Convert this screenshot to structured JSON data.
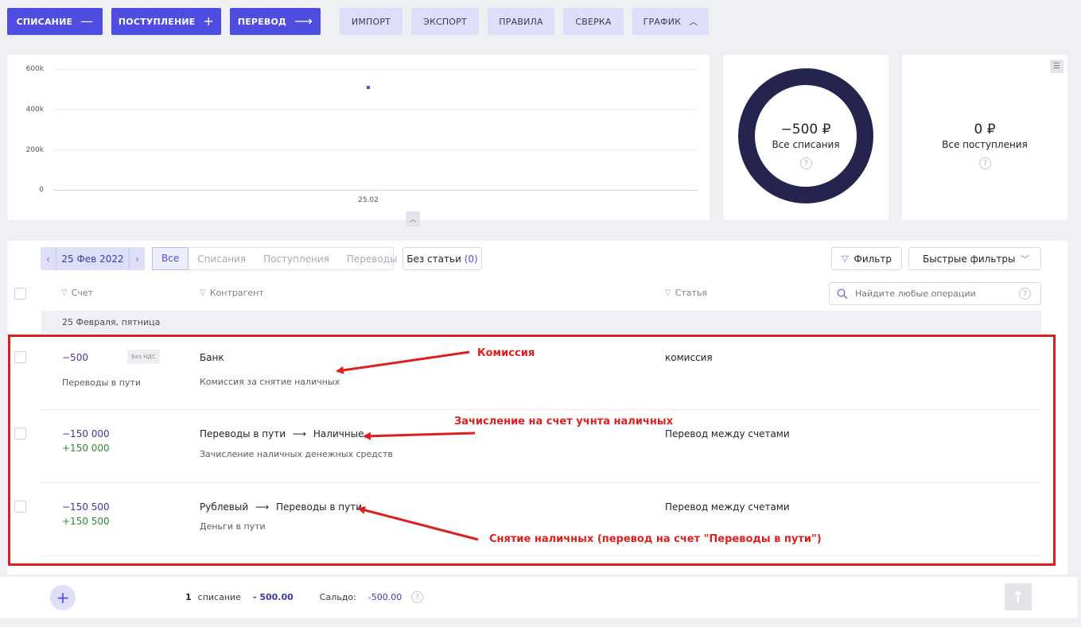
{
  "toolbar": {
    "writeoff": "СПИСАНИЕ",
    "income": "ПОСТУПЛЕНИЕ",
    "transfer": "ПЕРЕВОД",
    "import": "ИМПОРТ",
    "export": "ЭКСПОРТ",
    "rules": "ПРАВИЛА",
    "reconcile": "СВЕРКА",
    "chart": "ГРАФИК"
  },
  "chart_data": {
    "type": "scatter",
    "categories": [
      "25.02"
    ],
    "yticks": [
      "600k",
      "400k",
      "200k",
      "0"
    ],
    "ylim": [
      0,
      600000
    ],
    "series": [
      {
        "values": [
          510000
        ],
        "color": "#4f4de0"
      }
    ]
  },
  "summary": {
    "writeoffs_value": "−500 ₽",
    "writeoffs_label": "Все списания",
    "income_value": "0 ₽",
    "income_label": "Все поступления",
    "help": "?"
  },
  "filters": {
    "date": "25 Фев 2022",
    "tabs": [
      "Все",
      "Списания",
      "Поступления",
      "Переводы"
    ],
    "no_article": "Без статьи",
    "no_article_count": "(0)",
    "filter": "Фильтр",
    "quick_filters": "Быстрые фильтры",
    "search_placeholder": "Найдите любые операции"
  },
  "columns": {
    "account": "Счет",
    "counterparty": "Контрагент",
    "article": "Статья"
  },
  "group_header": "25 Февраля, пятница",
  "rows": [
    {
      "amount1": "−500",
      "badge": "Без НДС",
      "account": "Переводы в пути",
      "counterparty": "Банк",
      "description": "Комиссия за снятие наличных",
      "article": "комиссия"
    },
    {
      "amount1": "−150 000",
      "amount2": "+150 000",
      "from": "Переводы в пути",
      "to": "Наличные",
      "description": "Зачисление наличных денежных средств",
      "article": "Перевод между счетами"
    },
    {
      "amount1": "−150 500",
      "amount2": "+150 500",
      "from": "Рублевый",
      "to": "Переводы в пути",
      "description": "Деньги в пути",
      "article": "Перевод между счетами"
    }
  ],
  "annotations": {
    "a1": "Комиссия",
    "a2": "Зачисление на счет учнта наличных",
    "a3": "Снятие наличных (перевод на счет \"Переводы в пути\")"
  },
  "footer": {
    "count": "1",
    "count_label": "списание",
    "sum": "- 500.00",
    "balance_label": "Сальдо:",
    "balance": "-500.00"
  },
  "colors": {
    "accent": "#4f4de0",
    "donut": "#25244f",
    "annotation": "#dd1f1f",
    "positive": "#2f8a3a"
  }
}
